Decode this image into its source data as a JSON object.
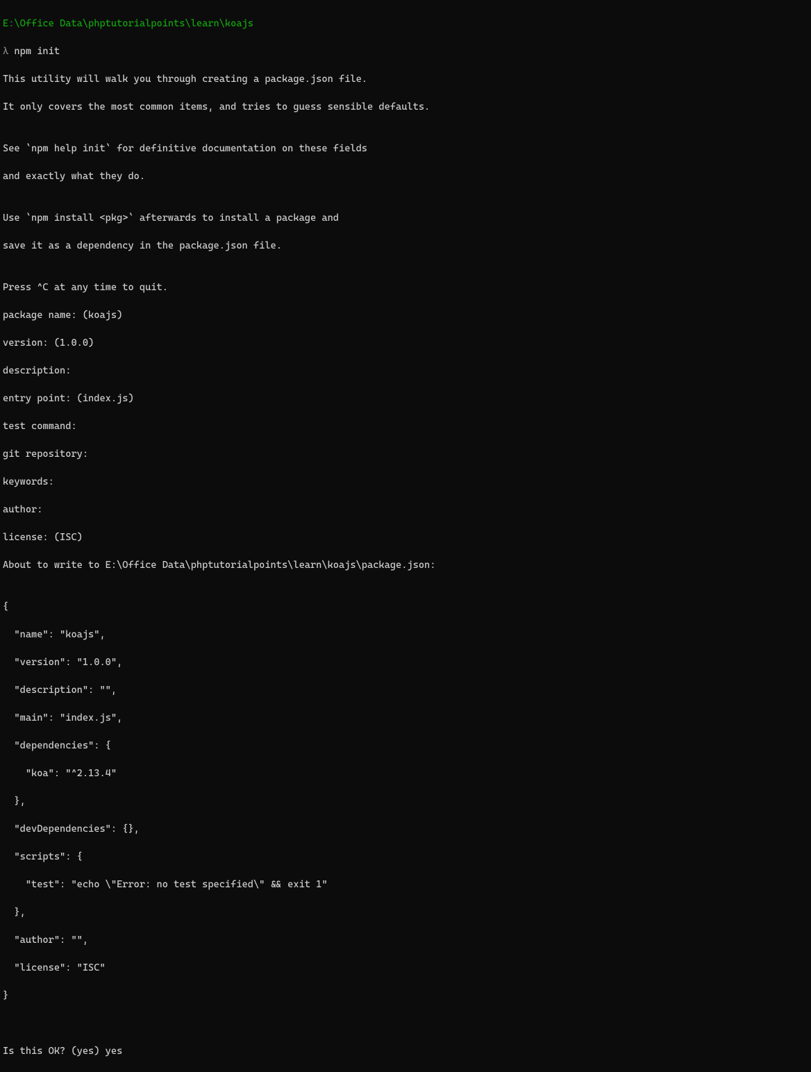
{
  "prompt": {
    "path": "E:\\Office Data\\phptutorialpoints\\learn\\koajs",
    "symbol": "λ",
    "command": "npm init"
  },
  "lines": [
    "This utility will walk you through creating a package.json file.",
    "It only covers the most common items, and tries to guess sensible defaults.",
    "",
    "See `npm help init` for definitive documentation on these fields",
    "and exactly what they do.",
    "",
    "Use `npm install <pkg>` afterwards to install a package and",
    "save it as a dependency in the package.json file.",
    "",
    "Press ^C at any time to quit.",
    "package name: (koajs)",
    "version: (1.0.0)",
    "description:",
    "entry point: (index.js)",
    "test command:",
    "git repository:",
    "keywords:",
    "author:",
    "license: (ISC)",
    "About to write to E:\\Office Data\\phptutorialpoints\\learn\\koajs\\package.json:",
    "",
    "{",
    "  \"name\": \"koajs\",",
    "  \"version\": \"1.0.0\",",
    "  \"description\": \"\",",
    "  \"main\": \"index.js\",",
    "  \"dependencies\": {",
    "    \"koa\": \"^2.13.4\"",
    "  },",
    "  \"devDependencies\": {},",
    "  \"scripts\": {",
    "    \"test\": \"echo \\\"Error: no test specified\\\" && exit 1\"",
    "  },",
    "  \"author\": \"\",",
    "  \"license\": \"ISC\"",
    "}",
    "",
    "",
    "Is this OK? (yes) yes"
  ]
}
